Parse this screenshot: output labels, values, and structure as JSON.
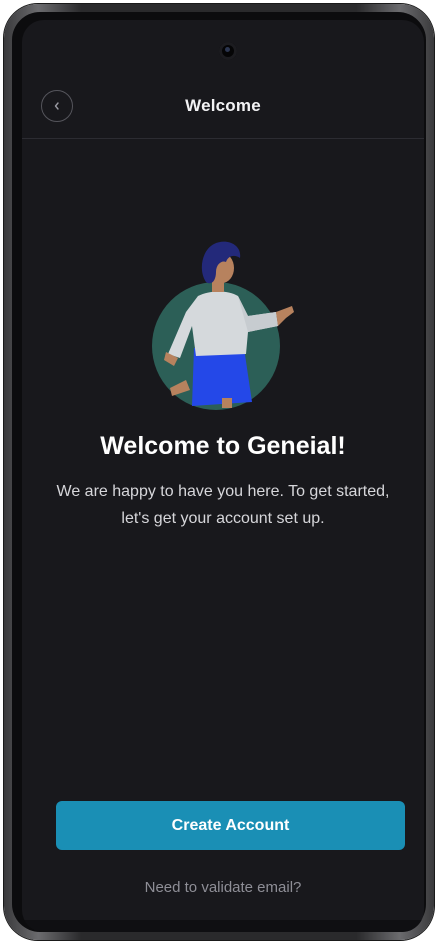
{
  "header": {
    "title": "Welcome",
    "back_icon": "chevron-left-icon"
  },
  "illustration": {
    "name": "welcome-person-illustration",
    "colors": {
      "circle": "#2c5f57",
      "skirt": "#2448e8",
      "shirt": "#d5d9dc",
      "hair": "#23297a",
      "skin": "#b7825e"
    }
  },
  "main": {
    "title": "Welcome to Geneial!",
    "subtitle": "We are happy to have you here. To get started, let's get your account set up."
  },
  "actions": {
    "create_account_label": "Create Account",
    "validate_email_label": "Need to validate email?"
  },
  "colors": {
    "background": "#18181c",
    "accent": "#1a8fb5",
    "muted_text": "#8e8e96"
  }
}
